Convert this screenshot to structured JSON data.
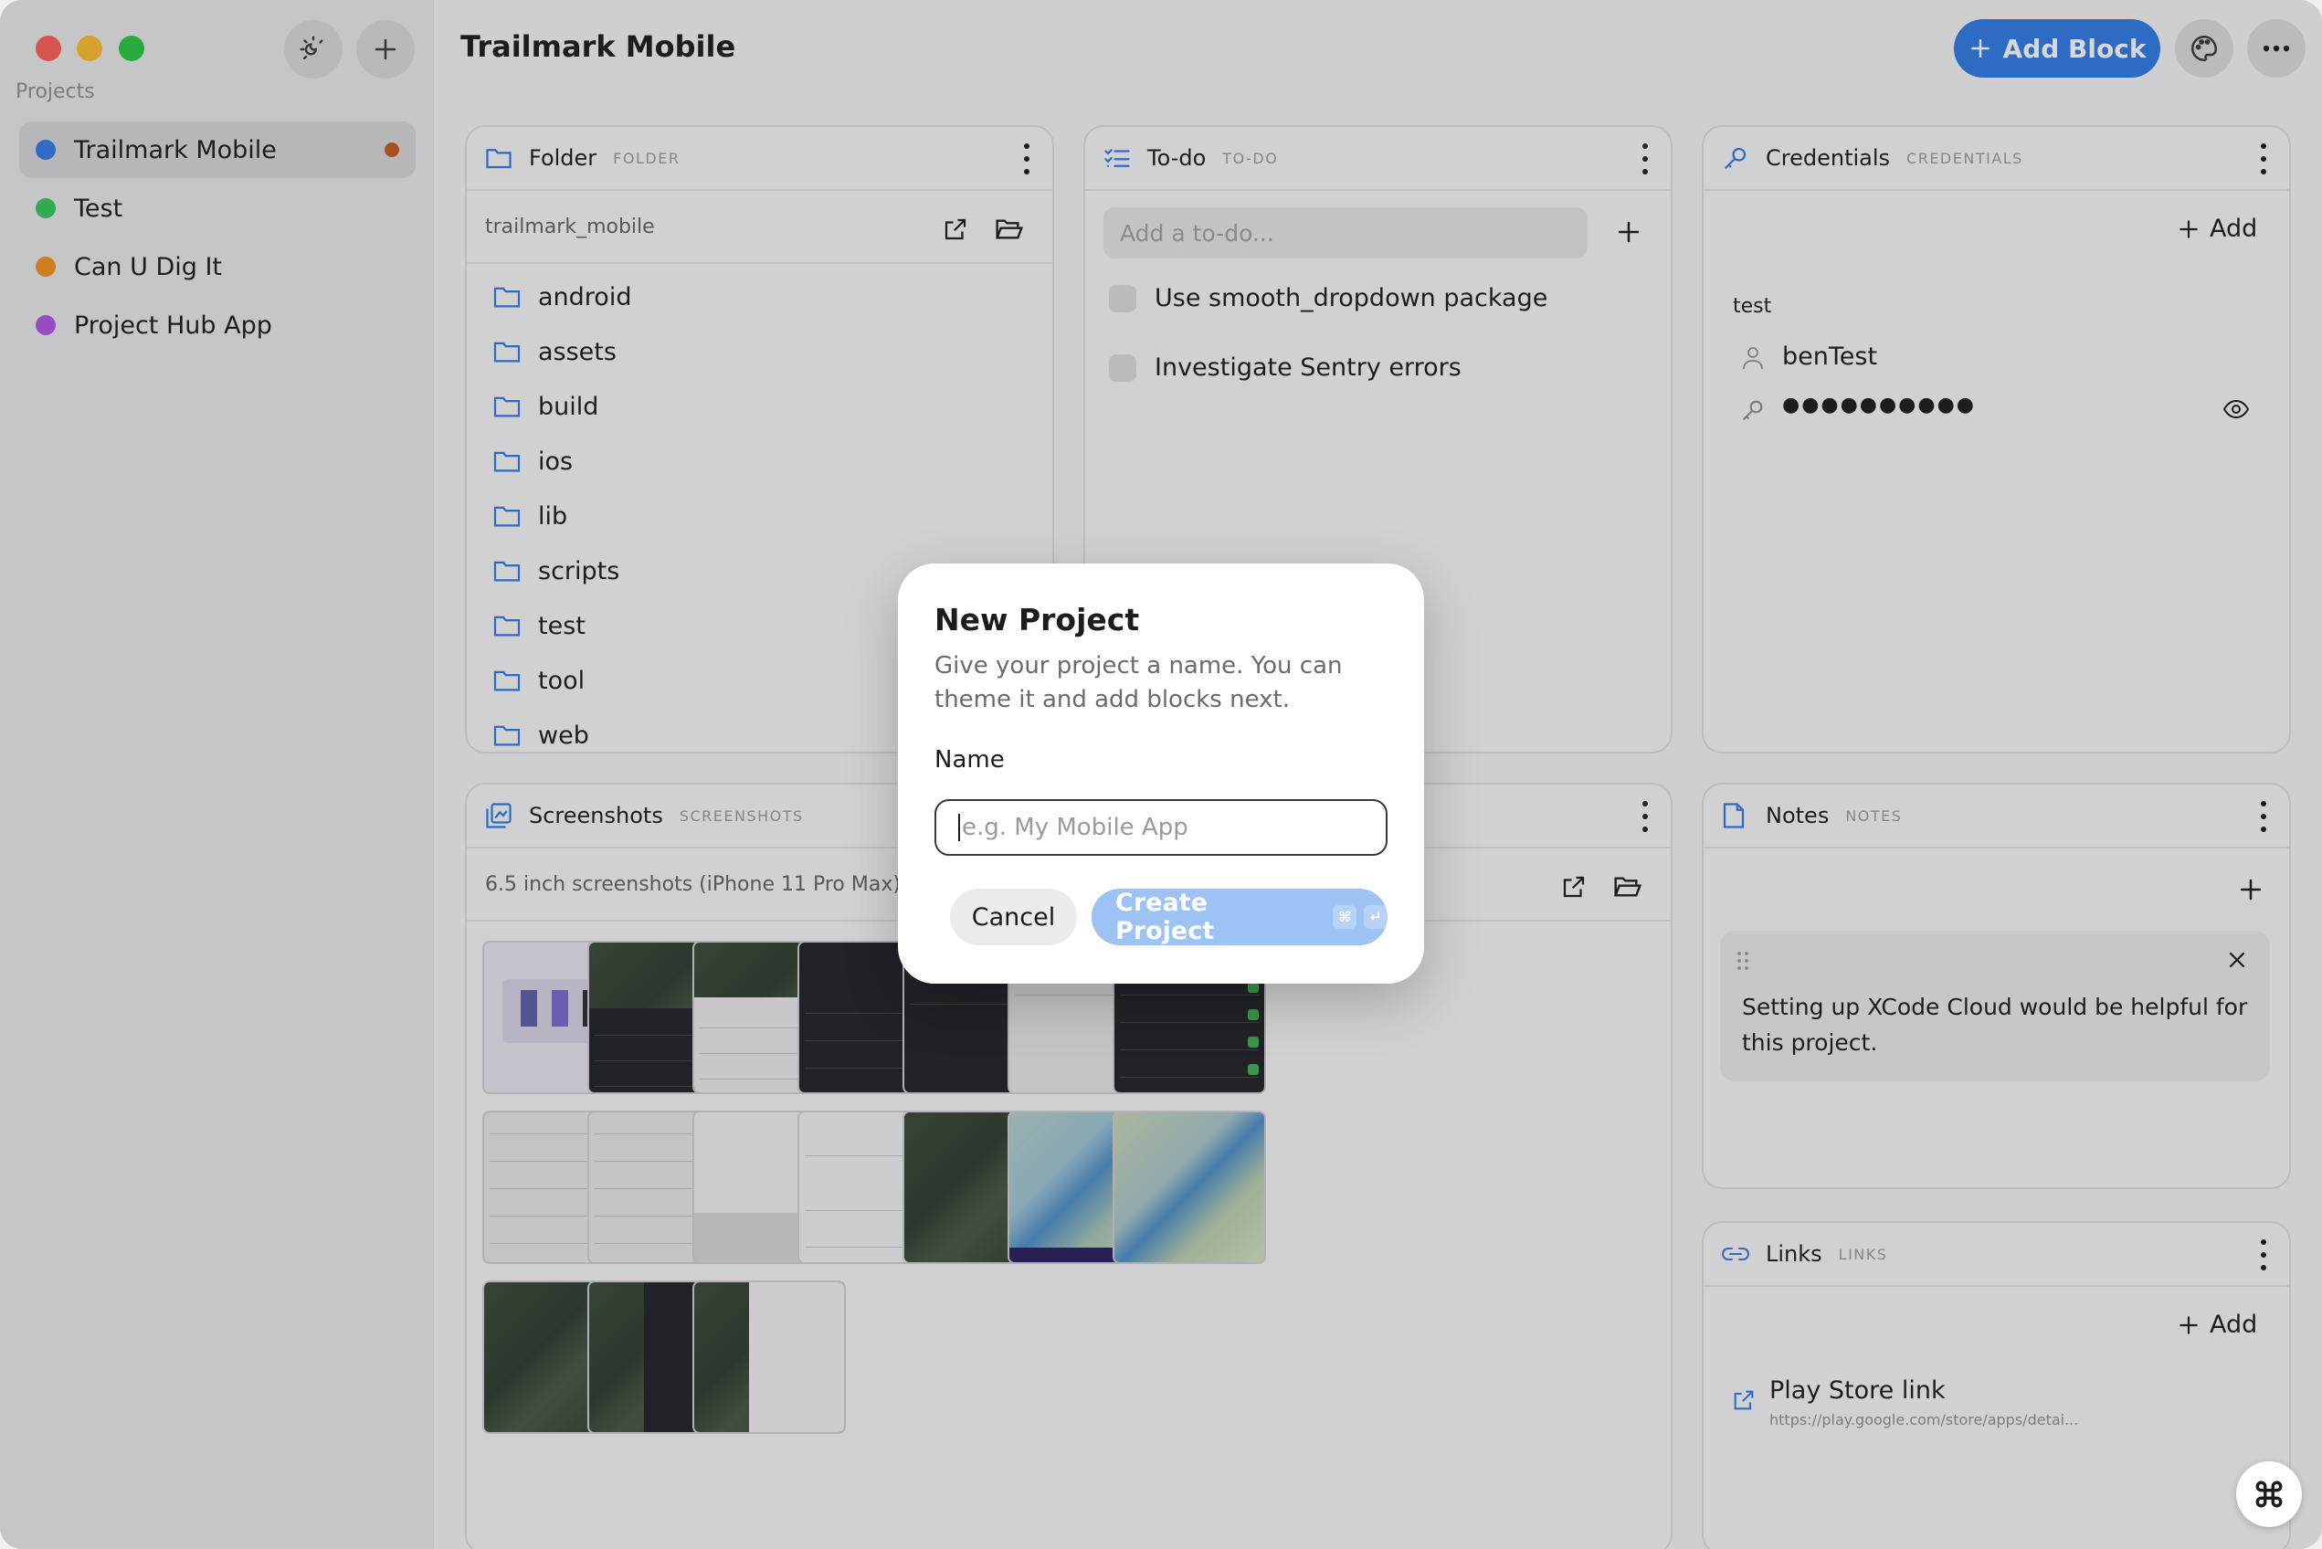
{
  "window": {
    "title": "Trailmark Mobile"
  },
  "sidebar": {
    "section_label": "Projects",
    "projects": [
      {
        "name": "Trailmark Mobile",
        "color": "#2f7ae6",
        "active": true
      },
      {
        "name": "Test",
        "color": "#34c759"
      },
      {
        "name": "Can U Dig It",
        "color": "#f0931e"
      },
      {
        "name": "Project Hub App",
        "color": "#b055e0"
      }
    ]
  },
  "header": {
    "add_block_label": "Add Block"
  },
  "folder_card": {
    "title": "Folder",
    "type_label": "FOLDER",
    "path": "trailmark_mobile",
    "items": [
      "android",
      "assets",
      "build",
      "ios",
      "lib",
      "scripts",
      "test",
      "tool",
      "web"
    ]
  },
  "todo_card": {
    "title": "To-do",
    "type_label": "TO-DO",
    "placeholder": "Add a to-do...",
    "items": [
      "Use smooth_dropdown package",
      "Investigate Sentry errors"
    ]
  },
  "credentials_card": {
    "title": "Credentials",
    "type_label": "CREDENTIALS",
    "add_label": "Add",
    "entry_name": "test",
    "username": "benTest",
    "password_mask": "●●●●●●●●●●"
  },
  "screenshots_card": {
    "title": "Screenshots",
    "type_label": "SCREENSHOTS",
    "path": "6.5 inch screenshots (iPhone 11 Pro Max)",
    "count": "17"
  },
  "notes_card": {
    "title": "Notes",
    "type_label": "NOTES",
    "note_text": "Setting up XCode Cloud would be helpful for this project."
  },
  "links_card": {
    "title": "Links",
    "type_label": "LINKS",
    "add_label": "Add",
    "link_title": "Play Store link",
    "link_url": "https://play.google.com/store/apps/detai..."
  },
  "modal": {
    "title": "New Project",
    "description": "Give your project a name. You can theme it and add blocks next.",
    "name_label": "Name",
    "name_placeholder": "e.g. My Mobile App",
    "cancel_label": "Cancel",
    "create_label": "Create Project",
    "shortcut_cmd": "⌘",
    "shortcut_enter": "↵"
  },
  "colors": {
    "accent": "#2f7ae6",
    "create_disabled": "#9cc3f3"
  }
}
